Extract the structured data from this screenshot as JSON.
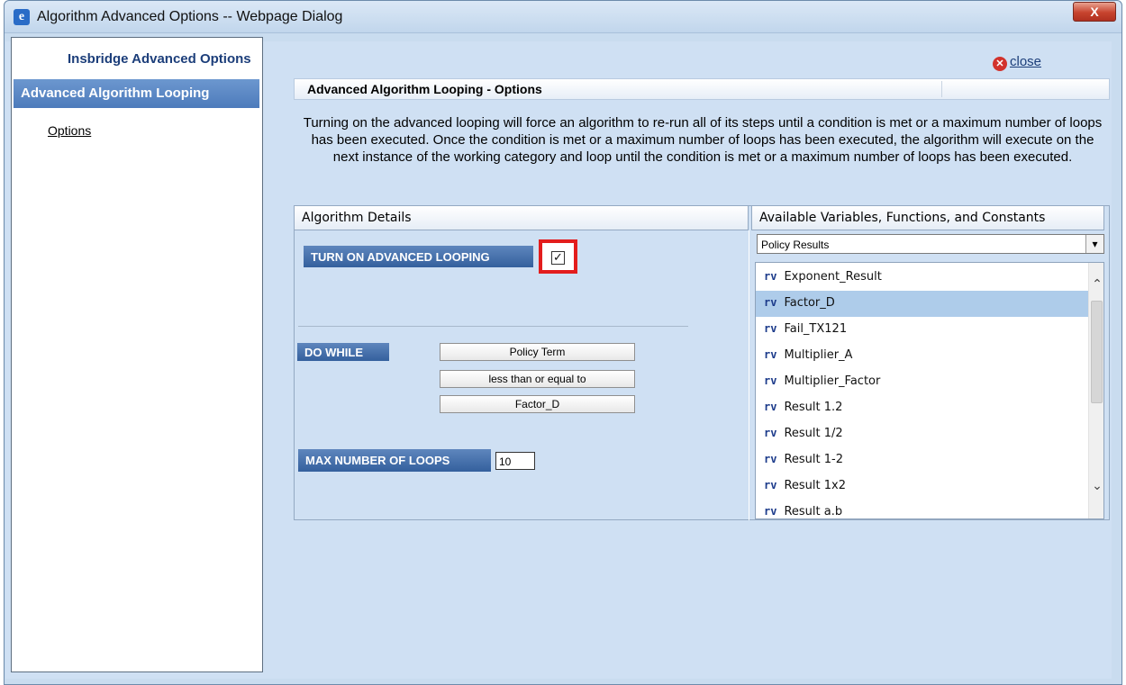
{
  "window": {
    "title": "Algorithm Advanced Options -- Webpage Dialog",
    "close_glyph": "X"
  },
  "left_panel": {
    "title": "Insbridge Advanced Options",
    "active_item": "Advanced Algorithm Looping",
    "links": [
      "Options"
    ]
  },
  "close_link": "close",
  "header": {
    "title": "Advanced Algorithm Looping - Options"
  },
  "description": "Turning on the advanced looping will force an algorithm to re-run all of its steps until a condition is met or a maximum number of loops has been executed. Once the condition is met or a maximum number of loops has been executed, the algorithm will execute on the next instance of the working category and loop until the condition is met or a maximum number of loops has been executed.",
  "algorithm_details": {
    "header": "Algorithm Details",
    "turn_on_label": "TURN ON ADVANCED LOOPING",
    "turn_on_checked": true,
    "do_while_label": "DO WHILE",
    "condition_left": "Policy Term",
    "condition_operator": "less than or equal to",
    "condition_right": "Factor_D",
    "max_loops_label": "MAX NUMBER OF LOOPS",
    "max_loops_value": "10"
  },
  "available": {
    "header": "Available Variables, Functions, and Constants",
    "dropdown_value": "Policy Results",
    "prefix": "rv",
    "selected_index": 1,
    "items": [
      "Exponent_Result",
      "Factor_D",
      "Fail_TX121",
      "Multiplier_A",
      "Multiplier_Factor",
      "Result 1.2",
      "Result 1/2",
      "Result 1-2",
      "Result 1x2",
      "Result a.b"
    ]
  }
}
